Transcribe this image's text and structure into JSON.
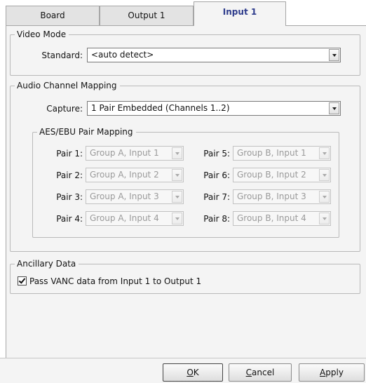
{
  "tabs": [
    {
      "label": "Board"
    },
    {
      "label": "Output 1"
    },
    {
      "label": "Input 1"
    }
  ],
  "video_mode": {
    "legend": "Video Mode",
    "standard_label": "Standard:",
    "standard_value": "<auto detect>"
  },
  "audio": {
    "legend": "Audio Channel Mapping",
    "capture_label": "Capture:",
    "capture_value": "1 Pair Embedded (Channels 1..2)",
    "aes_legend": "AES/EBU Pair Mapping",
    "pairs": [
      {
        "label": "Pair 1:",
        "value": "Group A, Input 1"
      },
      {
        "label": "Pair 2:",
        "value": "Group A, Input 2"
      },
      {
        "label": "Pair 3:",
        "value": "Group A, Input 3"
      },
      {
        "label": "Pair 4:",
        "value": "Group A, Input 4"
      },
      {
        "label": "Pair 5:",
        "value": "Group B, Input 1"
      },
      {
        "label": "Pair 6:",
        "value": "Group B, Input 2"
      },
      {
        "label": "Pair 7:",
        "value": "Group B, Input 3"
      },
      {
        "label": "Pair 8:",
        "value": "Group B, Input 4"
      }
    ]
  },
  "ancillary": {
    "legend": "Ancillary Data",
    "pass_vanc_label": "Pass VANC data from Input 1 to Output 1",
    "pass_vanc_checked": true
  },
  "buttons": {
    "ok_first": "O",
    "ok_rest": "K",
    "cancel_first": "C",
    "cancel_rest": "ancel",
    "apply_first": "A",
    "apply_rest": "pply"
  }
}
